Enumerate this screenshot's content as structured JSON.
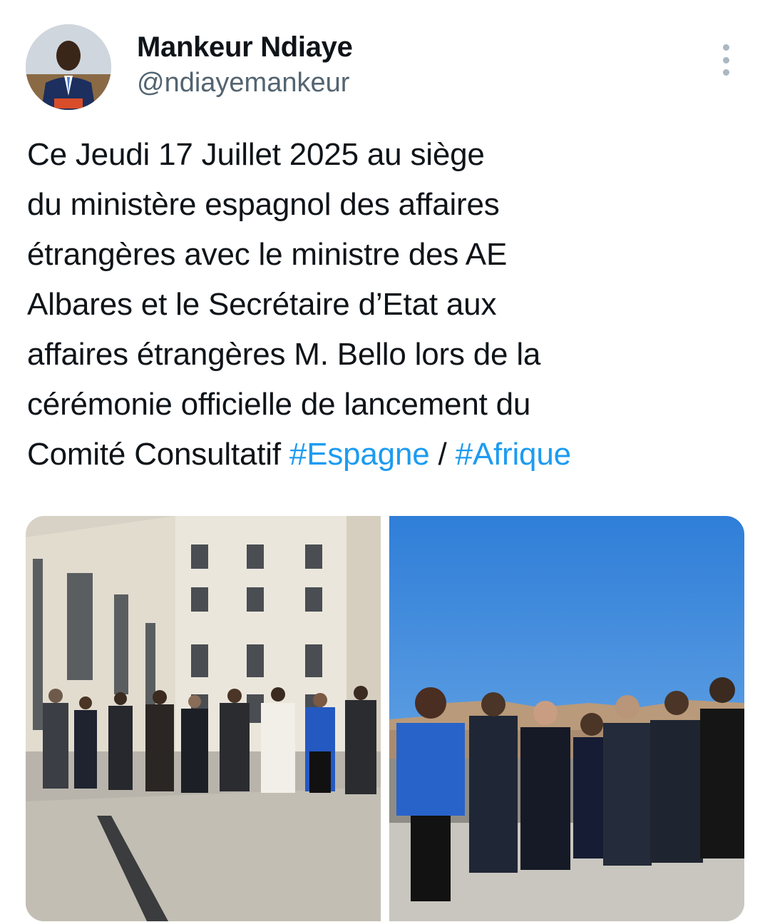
{
  "author": {
    "display_name": "Mankeur Ndiaye",
    "handle": "@ndiayemankeur",
    "avatar_icon": "profile-photo"
  },
  "menu": {
    "icon": "more-vertical-icon"
  },
  "tweet": {
    "text_lines": [
      "Ce Jeudi 17 Juillet 2025 au siège",
      "du ministère espagnol des affaires",
      "étrangères avec le ministre des AE",
      "Albares et le Secrétaire d’Etat aux",
      "affaires étrangères M. Bello lors de la",
      "cérémonie officielle de lancement du"
    ],
    "last_line_text": "Comité Consultatif",
    "hashtag_1": "#Espagne",
    "separator": " / ",
    "hashtag_2": "#Afrique"
  },
  "media": {
    "photo_1": "courtyard-group-photo",
    "photo_2": "rooftop-group-photo"
  },
  "colors": {
    "link": "#1d9bf0",
    "handle": "#536471",
    "text": "#0f1419"
  }
}
